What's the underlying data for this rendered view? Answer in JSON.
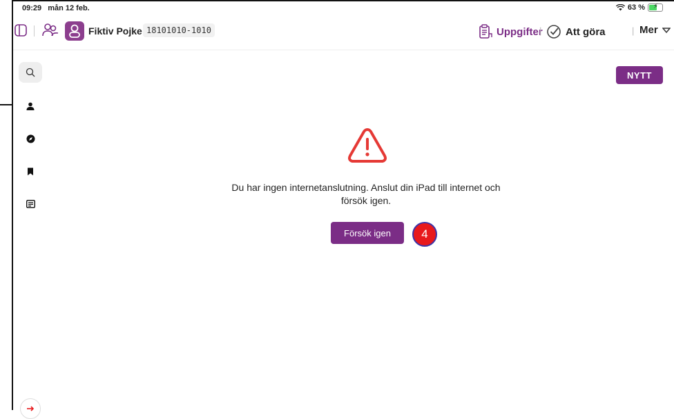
{
  "status": {
    "time": "09:29",
    "date": "mån 12 feb.",
    "battery": "63 %"
  },
  "topbar": {
    "patient_name": "Fiktiv Pojke",
    "patient_id": "18101010-1010",
    "uppgifter_label": "Uppgifter",
    "att_gora_label": "Att göra",
    "mer_label": "Mer"
  },
  "main": {
    "new_button": "NYTT",
    "message_line1": "Du har ingen internetanslutning. Anslut din iPad till internet och",
    "message_line2": "försök igen.",
    "retry_button": "Försök igen",
    "annotation_number": "4"
  },
  "colors": {
    "accent": "#7b2d86",
    "warning": "#e53935",
    "annotation": "#e8191c"
  },
  "icons": {
    "sidebar": [
      "search-icon",
      "person-icon",
      "compass-icon",
      "bookmark-icon",
      "document-icon"
    ],
    "bottom": "arrow-right-icon"
  }
}
